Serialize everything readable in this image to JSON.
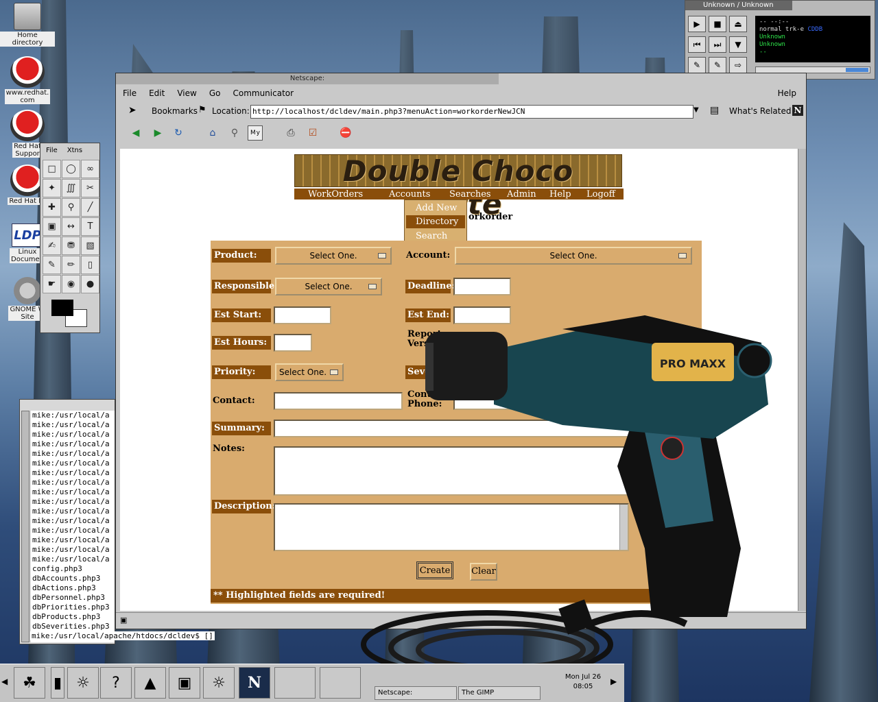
{
  "desktop": {
    "icons": [
      {
        "label": "Home directory"
      },
      {
        "label": "www.redhat.\ncom"
      },
      {
        "label": "Red Hat\nSuppor"
      },
      {
        "label": "Red Hat Er"
      },
      {
        "label": "Linux\nDocumen"
      },
      {
        "label": "GNOME W\nSite"
      }
    ]
  },
  "xmms": {
    "title": "Unknown / Unknown",
    "lcd_time": "--   --:--",
    "lcd_line1": "normal  trk-e",
    "lcd_line1_accent": "CDDB",
    "lcd_line2": "Unknown",
    "lcd_line3": "Unknown",
    "lcd_line4": "--",
    "volume_fraction": 0.2
  },
  "gimp": {
    "menu": [
      "File",
      "Xtns"
    ],
    "tools": [
      "select-rect-icon",
      "select-ellipse-icon",
      "lasso-icon",
      "magic-wand-icon",
      "bezier-icon",
      "scissors-icon",
      "move-icon",
      "zoom-icon",
      "pencil-line-icon",
      "crop-icon",
      "flip-icon",
      "text-icon",
      "color-picker-icon",
      "bucket-fill-icon",
      "gradient-icon",
      "pencil-icon",
      "brush-icon",
      "eraser-icon",
      "airbrush-icon",
      "clone-icon",
      "blur-icon"
    ]
  },
  "terminal": {
    "lines": [
      "mike:/usr/local/a",
      "mike:/usr/local/a",
      "mike:/usr/local/a",
      "mike:/usr/local/a",
      "mike:/usr/local/a",
      "mike:/usr/local/a",
      "mike:/usr/local/a",
      "mike:/usr/local/a",
      "mike:/usr/local/a",
      "mike:/usr/local/a",
      "mike:/usr/local/a",
      "mike:/usr/local/a",
      "mike:/usr/local/a",
      "mike:/usr/local/a",
      "mike:/usr/local/a",
      "mike:/usr/local/a",
      "config.php3",
      "dbAccounts.php3",
      "dbActions.php3",
      "dbPersonnel.php3",
      "dbPriorities.php3",
      "dbProducts.php3",
      "dbSeverities.php3"
    ],
    "prompt": "mike:/usr/local/apache/htdocs/dcldev$ []"
  },
  "netscape": {
    "title": "Netscape:",
    "menu": [
      "File",
      "Edit",
      "View",
      "Go",
      "Communicator"
    ],
    "help": "Help",
    "bookmarks": "Bookmarks",
    "location_label": "Location:",
    "url": "http://localhost/dcldev/main.php3?menuAction=workorderNewJCN",
    "whats_related": "What's Related"
  },
  "dcl": {
    "banner": "Double Choco Latte",
    "nav": [
      "WorkOrders",
      "Accounts",
      "Searches",
      "Admin",
      "Help",
      "Logoff"
    ],
    "dropdown": [
      "Add New",
      "Directory",
      "Search"
    ],
    "heading": "orkorder",
    "form": {
      "product_label": "Product:",
      "product_value": "Select One.",
      "account_label": "Account:",
      "account_value": "Select One.",
      "responsible_label": "Responsible:",
      "responsible_value": "Select One.",
      "deadline_label": "Deadline:",
      "est_start_label": "Est Start:",
      "est_end_label": "Est End:",
      "est_hours_label": "Est Hours:",
      "reported_label": "Report",
      "version_label": "Versi",
      "priority_label": "Priority:",
      "priority_value": "Select One.",
      "severity_label": "Seve",
      "contact_label": "Contact:",
      "contact_phone_label_1": "Contact",
      "contact_phone_label_2": "Phone:",
      "summary_label": "Summary:",
      "notes_label": "Notes:",
      "description_label": "Description:",
      "create_button": "Create",
      "clear_button": "Clear",
      "required_note": "** Highlighted fields are required!"
    }
  },
  "drill": {
    "brand": "PRO MAXX"
  },
  "panel": {
    "clock_line1": "Mon Jul 26",
    "clock_line2": "08:05",
    "tasks": [
      "Netscape:",
      "The GIMP"
    ]
  }
}
